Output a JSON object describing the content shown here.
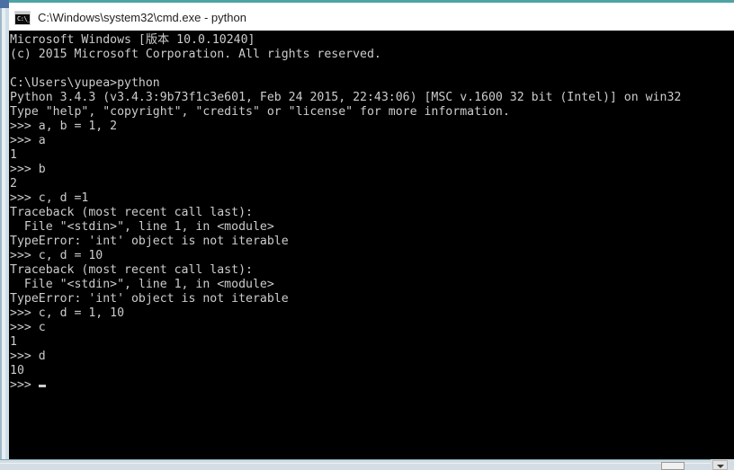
{
  "window": {
    "title": "C:\\Windows\\system32\\cmd.exe - python",
    "icon": "cmd-console-icon",
    "icon_glyph": "C:\\_",
    "title_bar_accent": "#4fa3a3",
    "console_background": "#000000",
    "console_foreground": "#cccccc"
  },
  "console": {
    "prompt_symbol": ">>>",
    "cursor": "block-cursor",
    "lines": [
      "Microsoft Windows [版本 10.0.10240]",
      "(c) 2015 Microsoft Corporation. All rights reserved.",
      "",
      "C:\\Users\\yupea>python",
      "Python 3.4.3 (v3.4.3:9b73f1c3e601, Feb 24 2015, 22:43:06) [MSC v.1600 32 bit (Intel)] on win32",
      "Type \"help\", \"copyright\", \"credits\" or \"license\" for more information.",
      ">>> a, b = 1, 2",
      ">>> a",
      "1",
      ">>> b",
      "2",
      ">>> c, d =1",
      "Traceback (most recent call last):",
      "  File \"<stdin>\", line 1, in <module>",
      "TypeError: 'int' object is not iterable",
      ">>> c, d = 10",
      "Traceback (most recent call last):",
      "  File \"<stdin>\", line 1, in <module>",
      "TypeError: 'int' object is not iterable",
      ">>> c, d = 1, 10",
      ">>> c",
      "1",
      ">>> d",
      "10"
    ],
    "last_line_prompt": ">>> "
  }
}
